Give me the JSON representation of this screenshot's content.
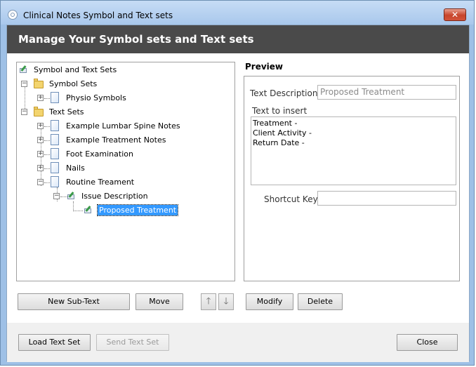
{
  "window": {
    "title": "Clinical Notes Symbol and Text sets",
    "close_glyph": "✕"
  },
  "banner": {
    "title": "Manage Your Symbol sets and Text sets"
  },
  "tree": {
    "root": "Symbol and Text Sets",
    "symbol_sets": "Symbol Sets",
    "physio_symbols": "Physio Symbols",
    "text_sets": "Text Sets",
    "items": [
      "Example Lumbar Spine Notes",
      "Example Treatment Notes",
      "Foot Examination",
      "Nails",
      "Routine Treament"
    ],
    "issue_description": "Issue Description",
    "proposed_treatment": "Proposed Treatment",
    "expand_glyph": "+",
    "collapse_glyph": "−"
  },
  "preview": {
    "title": "Preview",
    "text_description_label": "Text Description",
    "text_description_value": "Proposed Treatment",
    "text_to_insert_label": "Text to insert",
    "text_to_insert_lines": [
      "Treatment -",
      "Client Activity -",
      "Return Date -"
    ],
    "shortcut_key_label": "Shortcut Key",
    "shortcut_key_value": ""
  },
  "actions": {
    "new_sub_text": "New Sub-Text",
    "move": "Move",
    "up_glyph": "🡑",
    "down_glyph": "🡓",
    "modify": "Modify",
    "delete": "Delete"
  },
  "footer": {
    "load_text_set": "Load Text Set",
    "send_text_set": "Send Text Set",
    "close": "Close"
  },
  "colors": {
    "banner_bg": "#4a4a4a",
    "selection": "#3399ff",
    "window_frame": "#9ec0e6"
  }
}
